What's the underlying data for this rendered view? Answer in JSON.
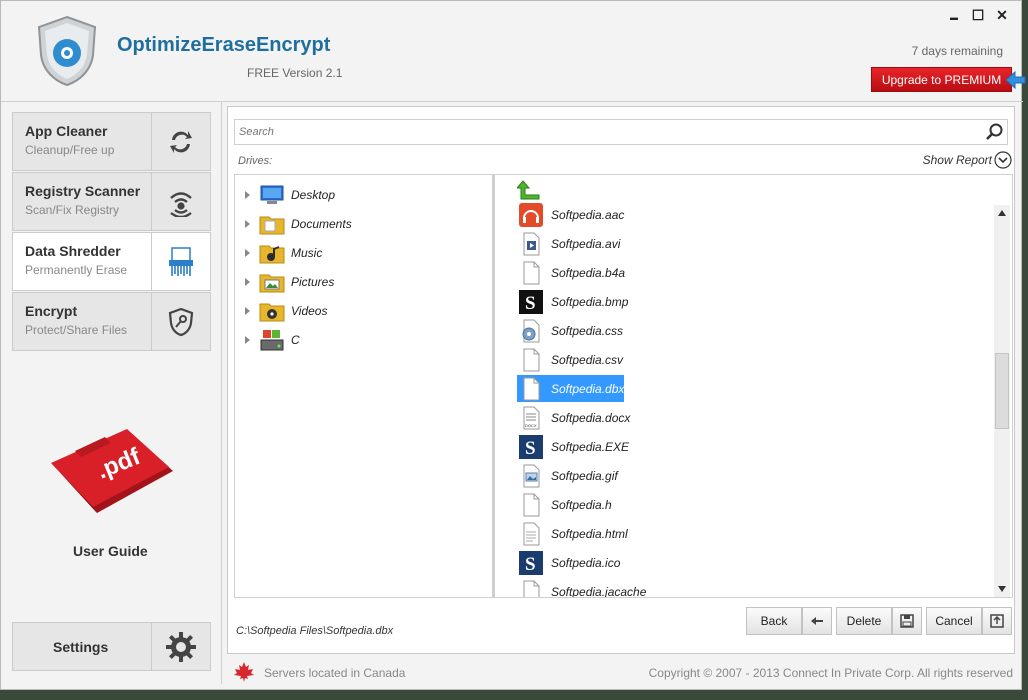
{
  "app": {
    "title": "OptimizeEraseEncrypt",
    "version": "FREE Version 2.1",
    "days_remaining": "7 days remaining",
    "upgrade_label": "Upgrade to PREMIUM"
  },
  "window_controls": {
    "minimize": "▬",
    "maximize": "☐",
    "close": "✕"
  },
  "sidebar": {
    "items": [
      {
        "title": "App Cleaner",
        "subtitle": "Cleanup/Free up",
        "icon": "refresh-icon"
      },
      {
        "title": "Registry Scanner",
        "subtitle": "Scan/Fix Registry",
        "icon": "signal-icon"
      },
      {
        "title": "Data Shredder",
        "subtitle": "Permanently Erase",
        "icon": "shredder-icon",
        "active": true
      },
      {
        "title": "Encrypt",
        "subtitle": "Protect/Share Files",
        "icon": "shield-key-icon"
      }
    ],
    "user_guide": "User Guide",
    "settings": "Settings"
  },
  "content": {
    "search_placeholder": "Search",
    "drives_label": "Drives:",
    "show_report": "Show Report",
    "drives": [
      {
        "label": "Desktop",
        "icon": "desktop-icon"
      },
      {
        "label": "Documents",
        "icon": "documents-folder-icon"
      },
      {
        "label": "Music",
        "icon": "music-folder-icon"
      },
      {
        "label": "Pictures",
        "icon": "pictures-folder-icon"
      },
      {
        "label": "Videos",
        "icon": "videos-folder-icon"
      },
      {
        "label": "C",
        "icon": "drive-icon"
      }
    ],
    "files": [
      {
        "label": "Softpedia.aac",
        "icon": "headphones-icon"
      },
      {
        "label": "Softpedia.avi",
        "icon": "video-file-icon"
      },
      {
        "label": "Softpedia.b4a",
        "icon": "blank-file-icon"
      },
      {
        "label": "Softpedia.bmp",
        "icon": "s-logo-icon"
      },
      {
        "label": "Softpedia.css",
        "icon": "gear-file-icon"
      },
      {
        "label": "Softpedia.csv",
        "icon": "blank-file-icon"
      },
      {
        "label": "Softpedia.dbx",
        "icon": "blank-file-icon",
        "selected": true
      },
      {
        "label": "Softpedia.docx",
        "icon": "docx-file-icon"
      },
      {
        "label": "Softpedia.EXE",
        "icon": "s-logo-icon"
      },
      {
        "label": "Softpedia.gif",
        "icon": "image-file-icon"
      },
      {
        "label": "Softpedia.h",
        "icon": "blank-file-icon"
      },
      {
        "label": "Softpedia.html",
        "icon": "text-file-icon"
      },
      {
        "label": "Softpedia.ico",
        "icon": "s-logo-icon"
      },
      {
        "label": "Softpedia.jacache",
        "icon": "blank-file-icon"
      }
    ],
    "current_path": "C:\\Softpedia Files\\Softpedia.dbx",
    "buttons": {
      "back": "Back",
      "delete": "Delete",
      "cancel": "Cancel"
    }
  },
  "footer": {
    "servers": "Servers located in Canada",
    "copyright": "Copyright © 2007 - 2013  Connect In Private Corp. All rights reserved"
  },
  "colors": {
    "brand": "#1f6f9e",
    "premium": "#d81a20",
    "selection": "#3399ff"
  }
}
